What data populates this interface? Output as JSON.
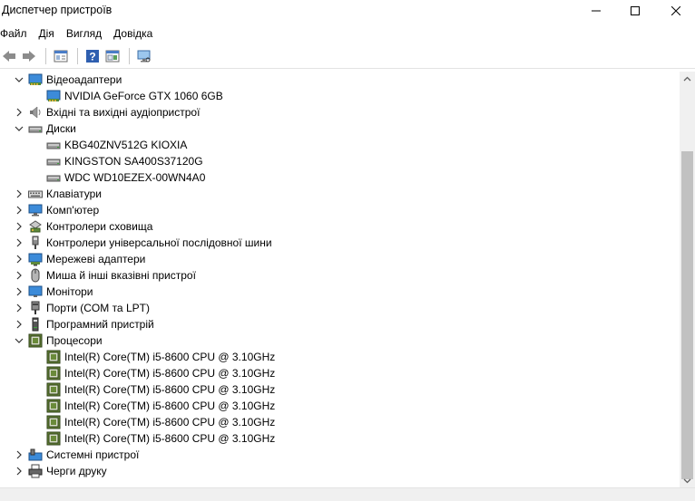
{
  "window": {
    "title": "Диспетчер пристроїв",
    "minimize_icon": "minimize-icon",
    "maximize_icon": "maximize-icon",
    "close_icon": "close-icon"
  },
  "menu": {
    "items": [
      {
        "label": "Файл"
      },
      {
        "label": "Дія"
      },
      {
        "label": "Вигляд"
      },
      {
        "label": "Довідка"
      }
    ]
  },
  "toolbar": {
    "buttons": [
      "back-arrow-icon",
      "forward-arrow-icon",
      "properties-icon",
      "help-icon",
      "update-driver-icon",
      "scan-hardware-icon"
    ]
  },
  "tree": {
    "categories": [
      {
        "label": "Відеоадаптери",
        "expanded": true,
        "icon": "display-adapter-icon",
        "children": [
          {
            "label": "NVIDIA GeForce GTX 1060 6GB",
            "icon": "display-adapter-icon"
          }
        ]
      },
      {
        "label": "Вхідні та вихідні аудіопристрої",
        "expanded": false,
        "icon": "speaker-icon",
        "children": []
      },
      {
        "label": "Диски",
        "expanded": true,
        "icon": "disk-drive-icon",
        "children": [
          {
            "label": "KBG40ZNV512G KIOXIA",
            "icon": "disk-drive-icon"
          },
          {
            "label": "KINGSTON SA400S37120G",
            "icon": "disk-drive-icon"
          },
          {
            "label": "WDC WD10EZEX-00WN4A0",
            "icon": "disk-drive-icon"
          }
        ]
      },
      {
        "label": "Клавіатури",
        "expanded": false,
        "icon": "keyboard-icon",
        "children": []
      },
      {
        "label": "Комп'ютер",
        "expanded": false,
        "icon": "computer-icon",
        "children": []
      },
      {
        "label": "Контролери сховища",
        "expanded": false,
        "icon": "storage-controller-icon",
        "children": []
      },
      {
        "label": "Контролери універсальної послідовної шини",
        "expanded": false,
        "icon": "usb-icon",
        "children": []
      },
      {
        "label": "Мережеві адаптери",
        "expanded": false,
        "icon": "network-adapter-icon",
        "children": []
      },
      {
        "label": "Миша й інші вказівні пристрої",
        "expanded": false,
        "icon": "mouse-icon",
        "children": []
      },
      {
        "label": "Монітори",
        "expanded": false,
        "icon": "monitor-icon",
        "children": []
      },
      {
        "label": "Порти (COM та LPT)",
        "expanded": false,
        "icon": "port-icon",
        "children": []
      },
      {
        "label": "Програмний пристрій",
        "expanded": false,
        "icon": "software-device-icon",
        "children": []
      },
      {
        "label": "Процесори",
        "expanded": true,
        "icon": "processor-icon",
        "children": [
          {
            "label": "Intel(R) Core(TM) i5-8600 CPU @ 3.10GHz",
            "icon": "processor-icon"
          },
          {
            "label": "Intel(R) Core(TM) i5-8600 CPU @ 3.10GHz",
            "icon": "processor-icon"
          },
          {
            "label": "Intel(R) Core(TM) i5-8600 CPU @ 3.10GHz",
            "icon": "processor-icon"
          },
          {
            "label": "Intel(R) Core(TM) i5-8600 CPU @ 3.10GHz",
            "icon": "processor-icon"
          },
          {
            "label": "Intel(R) Core(TM) i5-8600 CPU @ 3.10GHz",
            "icon": "processor-icon"
          },
          {
            "label": "Intel(R) Core(TM) i5-8600 CPU @ 3.10GHz",
            "icon": "processor-icon"
          }
        ]
      },
      {
        "label": "Системні пристрої",
        "expanded": false,
        "icon": "system-device-icon",
        "children": []
      },
      {
        "label": "Черги друку",
        "expanded": false,
        "icon": "printer-icon",
        "children": []
      }
    ]
  },
  "colors": {
    "icon_blue": "#3c8bd9",
    "icon_green": "#6a8a3a",
    "scrollbar_thumb": "#c1c1c1"
  }
}
